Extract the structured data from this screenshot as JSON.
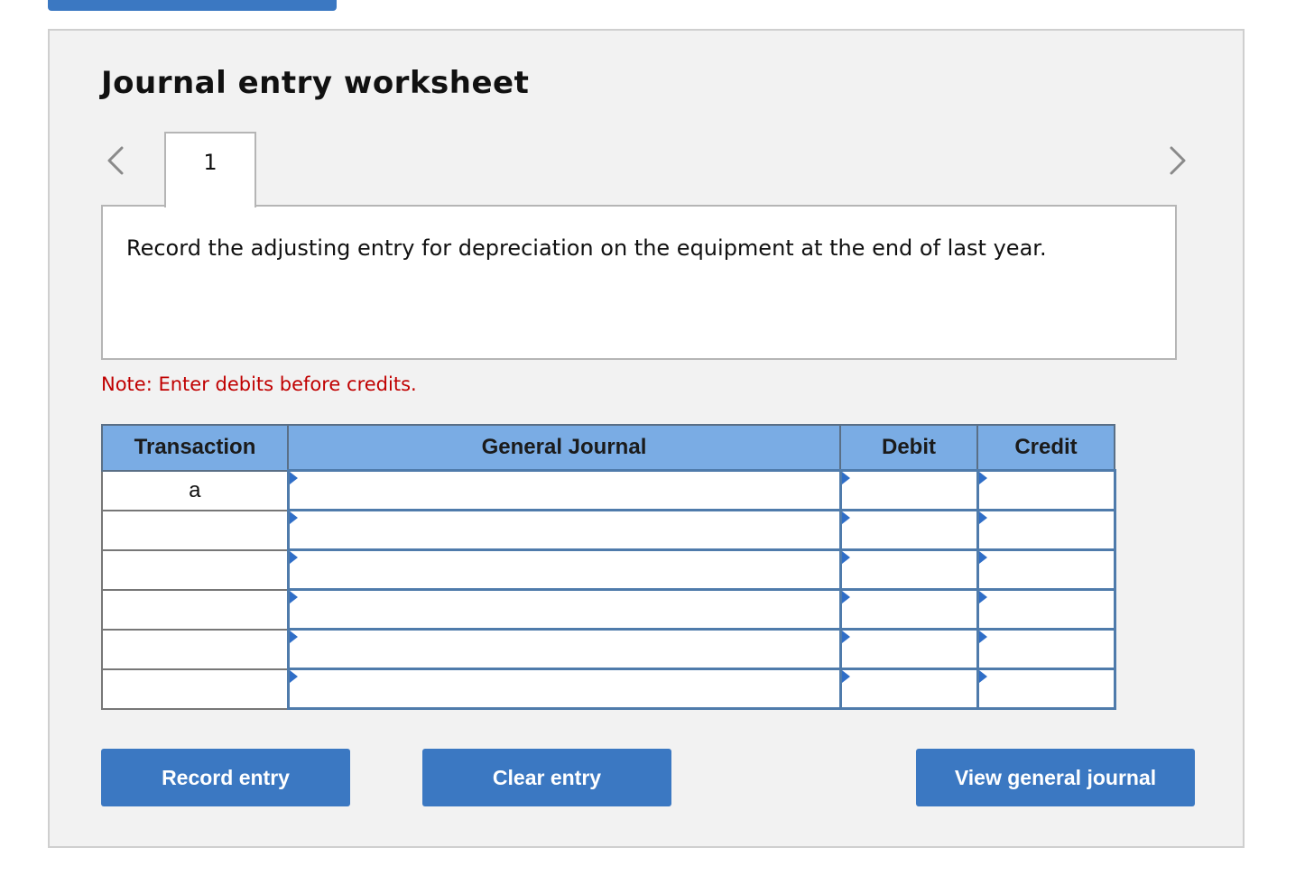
{
  "header": {
    "title": "Journal entry worksheet"
  },
  "navigation": {
    "prev_icon": "chevron-left-icon",
    "next_icon": "chevron-right-icon",
    "tabs": [
      {
        "label": "1",
        "active": true
      }
    ]
  },
  "prompt": {
    "text": "Record the adjusting entry for depreciation on the equipment at the end of last year."
  },
  "note": {
    "text": "Note: Enter debits before credits.",
    "color": "#c00000"
  },
  "table": {
    "columns": [
      "Transaction",
      "General Journal",
      "Debit",
      "Credit"
    ],
    "header_color": "#7aace4",
    "rows": [
      {
        "transaction": "a",
        "account": "",
        "debit": "",
        "credit": ""
      },
      {
        "transaction": "",
        "account": "",
        "debit": "",
        "credit": ""
      },
      {
        "transaction": "",
        "account": "",
        "debit": "",
        "credit": ""
      },
      {
        "transaction": "",
        "account": "",
        "debit": "",
        "credit": ""
      },
      {
        "transaction": "",
        "account": "",
        "debit": "",
        "credit": ""
      },
      {
        "transaction": "",
        "account": "",
        "debit": "",
        "credit": ""
      }
    ]
  },
  "buttons": {
    "record_label": "Record entry",
    "clear_label": "Clear entry",
    "view_label": "View general journal",
    "color": "#3b78c2"
  }
}
